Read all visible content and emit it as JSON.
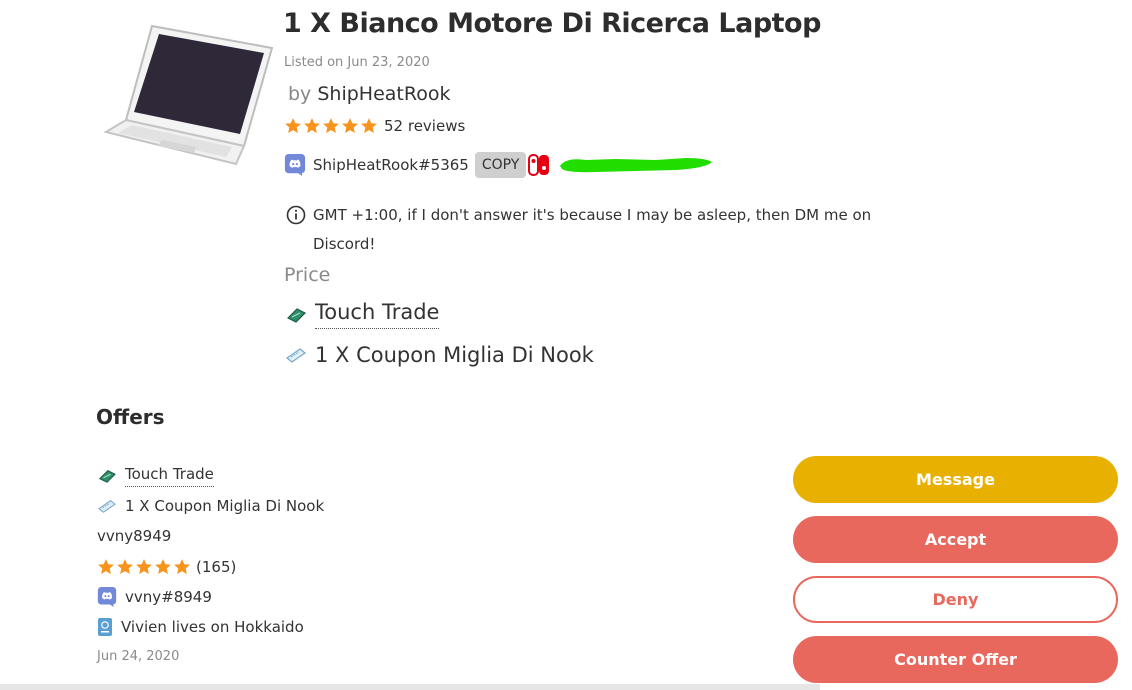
{
  "listing": {
    "title": "1 X Bianco Motore Di Ricerca Laptop",
    "listed": "Listed on Jun 23, 2020",
    "by_prefix": "by",
    "seller": "ShipHeatRook",
    "reviews": "52 reviews",
    "star_count": 5,
    "discord_tag": "ShipHeatRook#5365",
    "copy_label": "COPY",
    "note": "GMT +1:00, if I don't answer it's because I may be asleep, then DM me on Discord!",
    "price_label": "Price",
    "price_items": [
      {
        "label": "Touch Trade",
        "icon": "leaf-ticket-icon"
      },
      {
        "label": "1 X Coupon Miglia Di Nook",
        "icon": "nook-miles-ticket-icon"
      }
    ]
  },
  "offers": {
    "heading": "Offers",
    "items": [
      {
        "label": "Touch Trade",
        "icon": "leaf-ticket-icon"
      },
      {
        "label": "1 X Coupon Miglia Di Nook",
        "icon": "nook-miles-ticket-icon"
      }
    ],
    "user": "vvny8949",
    "rating_count": "(165)",
    "discord_tag": "vvny#8949",
    "island": "Vivien lives on Hokkaido",
    "date": "Jun 24, 2020"
  },
  "actions": {
    "message": "Message",
    "accept": "Accept",
    "deny": "Deny",
    "counter": "Counter Offer"
  },
  "colors": {
    "star": "#f7941d",
    "message": "#e8b000",
    "accept": "#e8685e",
    "discord": "#7289da",
    "switch": "#e60012",
    "redaction": "#22dd00"
  }
}
